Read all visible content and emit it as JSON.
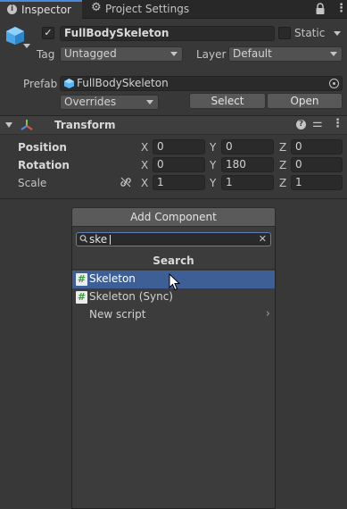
{
  "tabs": {
    "inspector": "Inspector",
    "project_settings": "Project Settings"
  },
  "gameobject": {
    "name": "FullBodySkeleton",
    "active": true,
    "static_label": "Static",
    "tag_label": "Tag",
    "tag_value": "Untagged",
    "layer_label": "Layer",
    "layer_value": "Default"
  },
  "prefab": {
    "label": "Prefab",
    "value": "FullBodySkeleton",
    "overrides": "Overrides",
    "select": "Select",
    "open": "Open"
  },
  "transform": {
    "title": "Transform",
    "rows": [
      {
        "label": "Position",
        "x": "0",
        "y": "0",
        "z": "0"
      },
      {
        "label": "Rotation",
        "x": "0",
        "y": "180",
        "z": "0"
      },
      {
        "label": "Scale",
        "x": "1",
        "y": "1",
        "z": "1"
      }
    ],
    "axis_x": "X",
    "axis_y": "Y",
    "axis_z": "Z"
  },
  "add_component": {
    "button": "Add Component",
    "search_value": "ske",
    "section_title": "Search",
    "results": [
      "Skeleton",
      "Skeleton (Sync)"
    ],
    "new_script": "New script"
  },
  "colors": {
    "background": "#383838",
    "selected": "#3e5f96",
    "script_icon": "#3c9b3c"
  }
}
